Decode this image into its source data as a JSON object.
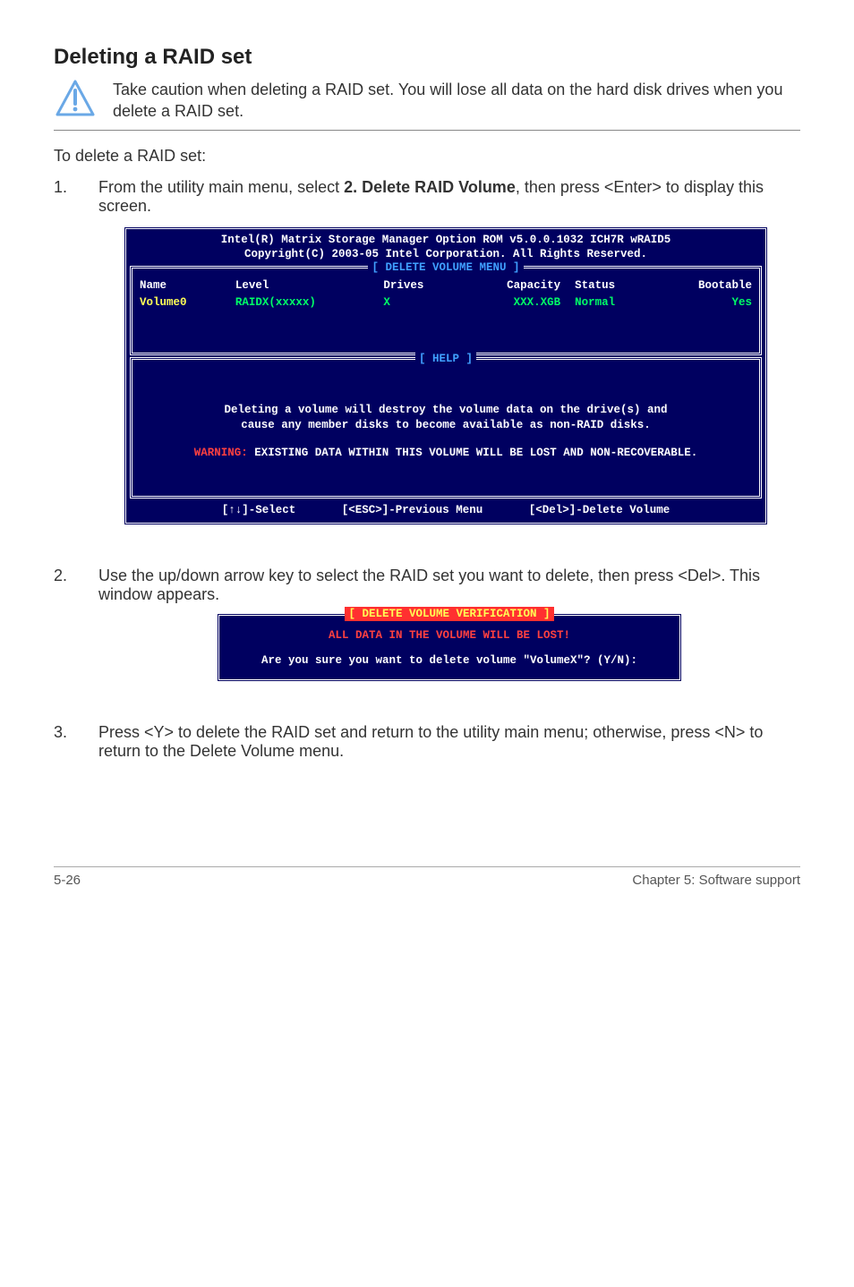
{
  "section": {
    "title": "Deleting a RAID set",
    "caution": "Take caution when deleting a RAID set. You will lose all data on the hard disk drives when you delete a RAID set.",
    "intro": "To delete a RAID set:",
    "step1_num": "1.",
    "step1_a": "From the utility main menu, select ",
    "step1_bold": "2. Delete RAID Volume",
    "step1_b": ", then press <Enter> to display this screen.",
    "step2_num": "2.",
    "step2": "Use the up/down arrow key to select the RAID set you want to delete, then press <Del>. This window appears.",
    "step3_num": "3.",
    "step3": "Press <Y> to delete the RAID set and return to the utility main menu; otherwise, press <N> to return to the Delete Volume menu."
  },
  "bios": {
    "title1": "Intel(R) Matrix Storage Manager Option ROM v5.0.0.1032 ICH7R wRAID5",
    "title2": "Copyright(C) 2003-05 Intel Corporation. All Rights Reserved.",
    "frame1_title": "[ DELETE VOLUME MENU ]",
    "cols": {
      "name": "Name",
      "level": "Level",
      "drives": "Drives",
      "capacity": "Capacity",
      "status": "Status",
      "bootable": "Bootable"
    },
    "row": {
      "name": "Volume0",
      "level": "RAIDX(xxxxx)",
      "drives": "X",
      "capacity": "XXX.XGB",
      "status": "Normal",
      "bootable": "Yes"
    },
    "help_title": "[ HELP ]",
    "help_line1": "Deleting a volume will destroy the volume data on the drive(s) and",
    "help_line2": "cause any member disks to become available as non-RAID disks.",
    "help_warn_prefix": "WARNING:",
    "help_warn_rest": " EXISTING DATA WITHIN THIS VOLUME WILL BE LOST AND NON-RECOVERABLE.",
    "footer_select": "[↑↓]-Select",
    "footer_prev": "[<ESC>]-Previous Menu",
    "footer_del": "[<Del>]-Delete Volume"
  },
  "dialog": {
    "title": "[ DELETE VOLUME VERIFICATION ]",
    "warn": "ALL DATA IN THE VOLUME WILL BE LOST!",
    "prompt": "Are you sure you want to delete volume \"VolumeX\"? (Y/N):"
  },
  "footer": {
    "left": "5-26",
    "right": "Chapter 5: Software support"
  }
}
